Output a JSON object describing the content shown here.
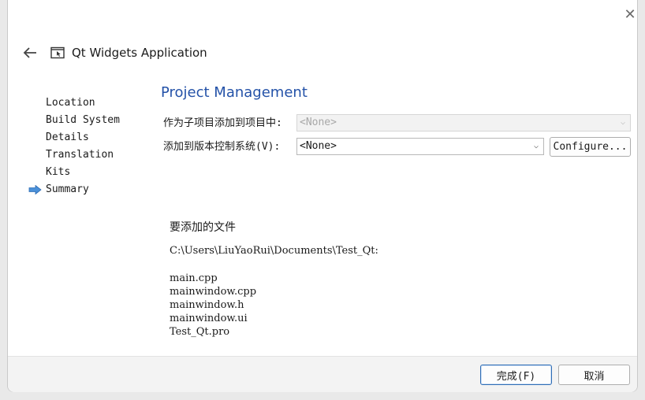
{
  "window": {
    "close_icon": "close-icon",
    "title": "Qt Widgets Application",
    "back_icon": "back-arrow-icon",
    "wizard_icon": "wizard-window-icon"
  },
  "steps": [
    {
      "label": "Location",
      "current": false
    },
    {
      "label": "Build System",
      "current": false
    },
    {
      "label": "Details",
      "current": false
    },
    {
      "label": "Translation",
      "current": false
    },
    {
      "label": "Kits",
      "current": false
    },
    {
      "label": "Summary",
      "current": true
    }
  ],
  "current_step_icon": "arrow-right-icon",
  "page": {
    "title": "Project Management",
    "add_as_subproject_label": "作为子项目添加到项目中:",
    "add_as_subproject_value": "<None>",
    "vcs_label": "添加到版本控制系统(V):",
    "vcs_value": "<None>",
    "configure_button": "Configure..."
  },
  "files": {
    "heading": "要添加的文件",
    "directory": "C:\\Users\\LiuYaoRui\\Documents\\Test_Qt:",
    "items": [
      "main.cpp",
      "mainwindow.cpp",
      "mainwindow.h",
      "mainwindow.ui",
      "Test_Qt.pro"
    ]
  },
  "footer": {
    "finish_button": "完成(F)",
    "cancel_button": "取消"
  },
  "colors": {
    "accent": "#2452a8",
    "arrow": "#4a90d9"
  }
}
